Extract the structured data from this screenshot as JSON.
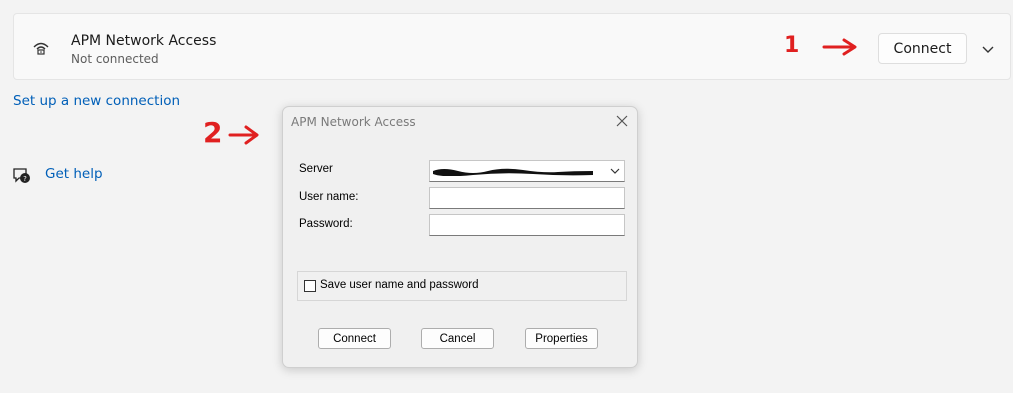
{
  "vpn_card": {
    "title": "APM Network Access",
    "status": "Not connected",
    "connect_label": "Connect"
  },
  "links": {
    "setup": "Set up a new connection",
    "help": "Get help"
  },
  "annotations": {
    "step1": "1",
    "step2": "2",
    "color": "#e02020"
  },
  "dialog": {
    "title": "APM Network Access",
    "server_label": "Server",
    "username_label": "User name:",
    "password_label": "Password:",
    "server_value": "",
    "username_value": "",
    "password_value": "",
    "save_label": "Save user name and password",
    "save_checked": false,
    "buttons": {
      "connect": "Connect",
      "cancel": "Cancel",
      "properties": "Properties"
    }
  }
}
